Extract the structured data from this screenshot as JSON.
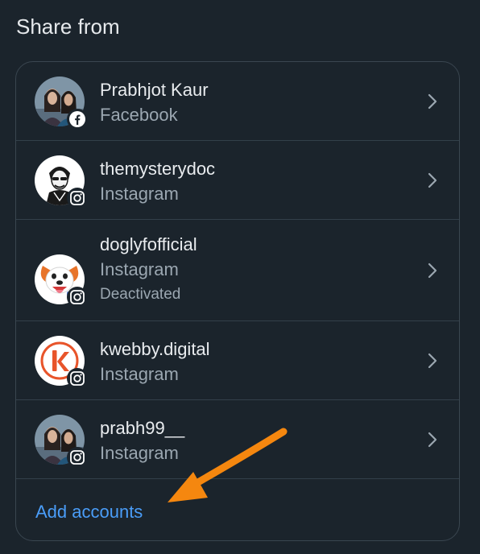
{
  "header": {
    "title": "Share from"
  },
  "accounts": [
    {
      "name": "Prabhjot Kaur",
      "platform": "Facebook",
      "status": "",
      "avatar": "woman-photo-avatar",
      "badge": "facebook-icon"
    },
    {
      "name": "themysterydoc",
      "platform": "Instagram",
      "status": "",
      "avatar": "sketch-man-avatar",
      "badge": "instagram-icon"
    },
    {
      "name": "doglyfofficial",
      "platform": "Instagram",
      "status": "Deactivated",
      "avatar": "cartoon-dog-avatar",
      "badge": "instagram-icon"
    },
    {
      "name": "kwebby.digital",
      "platform": "Instagram",
      "status": "",
      "avatar": "k-logo-avatar",
      "badge": "instagram-icon"
    },
    {
      "name": "prabh99__",
      "platform": "Instagram",
      "status": "",
      "avatar": "woman-photo-avatar",
      "badge": "instagram-icon"
    }
  ],
  "footer": {
    "add_label": "Add accounts"
  },
  "colors": {
    "background": "#1b242c",
    "link": "#4a9df8",
    "annotation_arrow": "#f5870f"
  }
}
